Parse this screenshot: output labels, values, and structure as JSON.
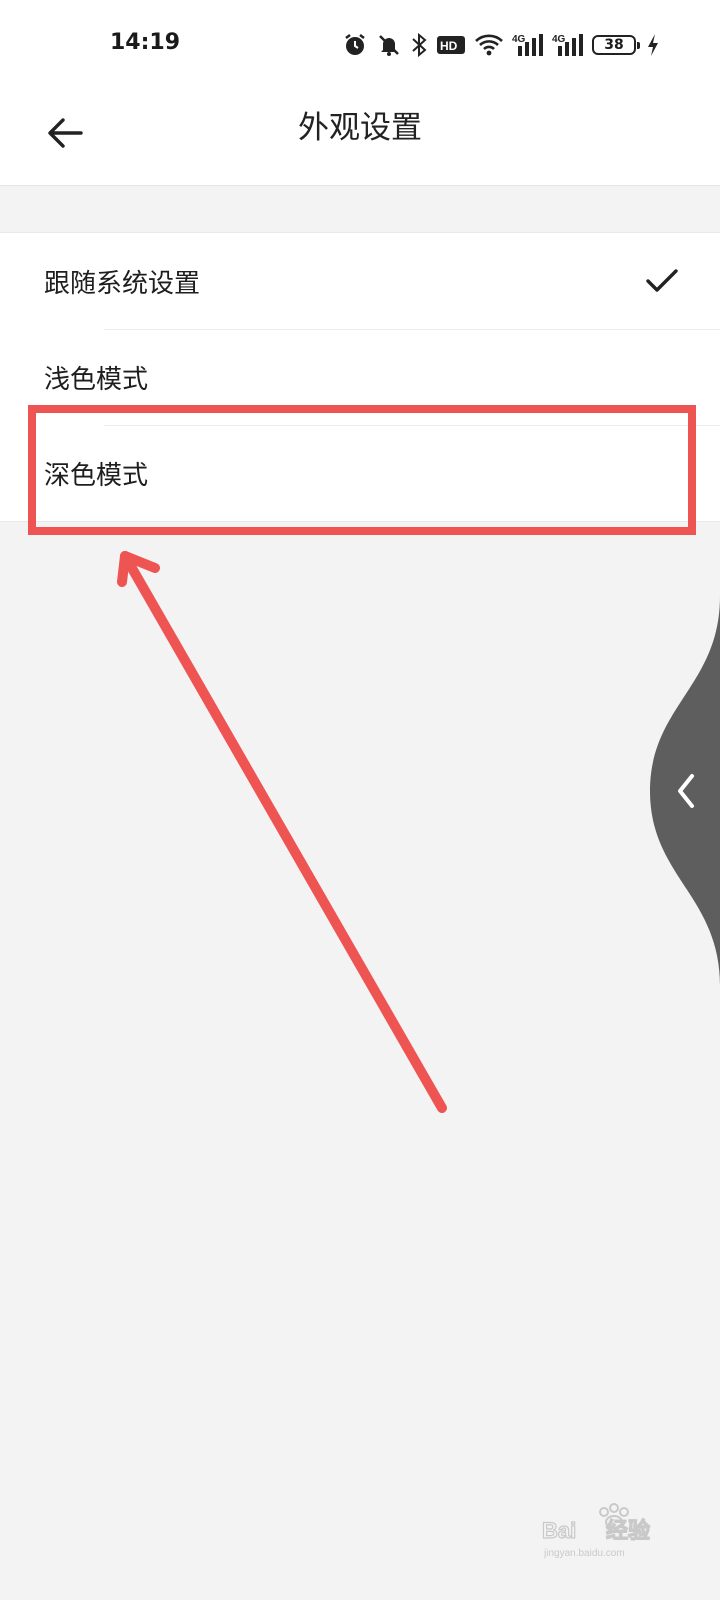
{
  "status_bar": {
    "time": "14:19",
    "battery_level": "38",
    "icons": [
      "alarm-icon",
      "mute-icon",
      "bluetooth-icon",
      "hd-icon",
      "wifi-icon",
      "signal-4g-icon",
      "signal-4g-icon",
      "battery-icon",
      "charging-icon"
    ]
  },
  "header": {
    "title": "外观设置",
    "back_icon": "back-arrow-icon"
  },
  "appearance_options": [
    {
      "label": "跟随系统设置",
      "selected": true
    },
    {
      "label": "浅色模式",
      "selected": false
    },
    {
      "label": "深色模式",
      "selected": false
    }
  ],
  "edge_gesture": {
    "icon": "chevron-left-icon"
  },
  "watermark": {
    "text": "Baidu经验",
    "subtext": "jingyan.baidu.com"
  },
  "colors": {
    "annotation_red": "#ee5452",
    "background": "#f4f3f4",
    "gesture_gray": "#5e5e5e"
  }
}
